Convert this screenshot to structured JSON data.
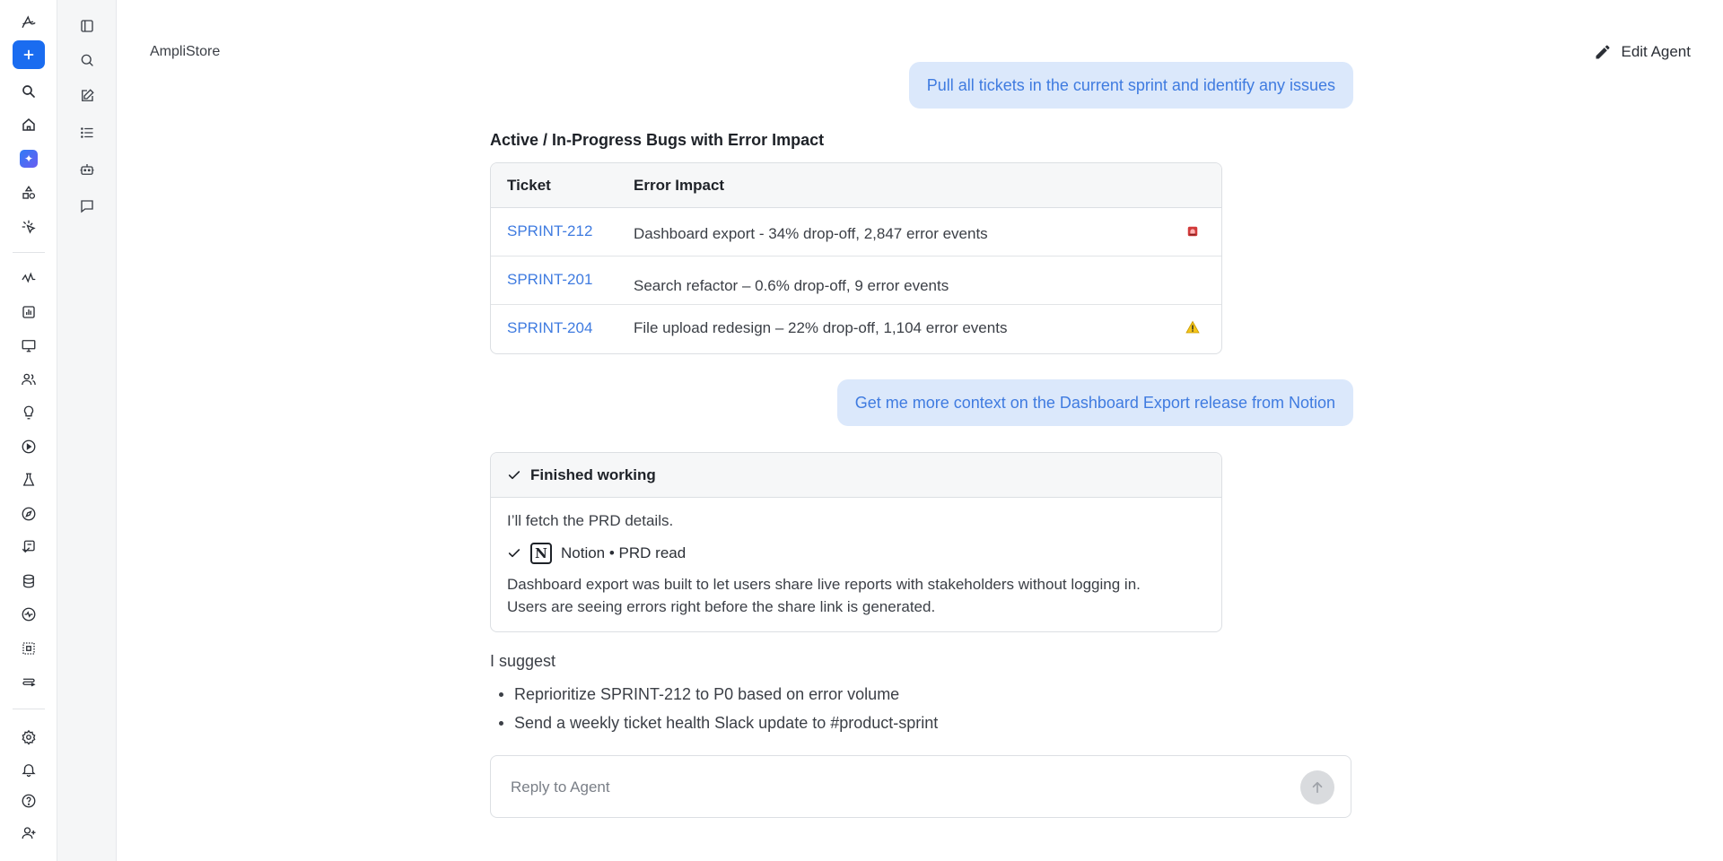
{
  "app": {
    "name": "AmpliStore"
  },
  "header": {
    "edit_agent_label": "Edit Agent"
  },
  "rail": {
    "items": [
      "logo-icon",
      "new-icon",
      "search-icon",
      "home-icon",
      "ai-assistant-icon",
      "shapes-icon",
      "sparkle-cursor-icon",
      "activity-icon",
      "bar-chart-icon",
      "monitor-icon",
      "users-icon",
      "lightbulb-icon",
      "play-circle-icon",
      "flask-icon",
      "compass-icon",
      "guide-icon",
      "database-icon",
      "health-icon",
      "object-icon",
      "flow-icon",
      "settings-icon",
      "bell-icon",
      "help-icon",
      "add-user-icon"
    ],
    "accent": "#1a6cf0"
  },
  "rail2": {
    "items": [
      "sidebar-toggle-icon",
      "search-icon",
      "edit-icon",
      "list-icon",
      "bot-icon",
      "chat-icon"
    ]
  },
  "conversation": {
    "user_msg_1": "Pull all tickets in the current sprint and identify any issues",
    "user_msg_2": "Get me more context on the Dashboard Export release from Notion",
    "table_title": "Active / In-Progress Bugs with Error Impact",
    "table": {
      "headers": [
        "Ticket",
        "Error Impact"
      ],
      "rows": [
        {
          "ticket": "SPRINT-212",
          "impact": "Dashboard export - 34% drop-off, 2,847 error events",
          "flag": "siren-icon"
        },
        {
          "ticket": "SPRINT-201",
          "impact": "Search refactor – 0.6% drop-off, 9 error events",
          "flag": ""
        },
        {
          "ticket": "SPRINT-204",
          "impact": "File upload redesign – 22% drop-off, 1,104 error events",
          "flag": "warning-icon"
        }
      ]
    },
    "work": {
      "status": "Finished working",
      "line1": "I’ll fetch the PRD details.",
      "tool": "Notion • PRD read",
      "desc_1": "Dashboard export was built to let users share live reports with stakeholders without logging in.",
      "desc_2": "Users are seeing errors right before the share link is generated."
    },
    "suggest": {
      "title": "I suggest",
      "items": [
        "Reprioritize SPRINT-212 to P0 based on error volume",
        "Send a weekly ticket health Slack update to #product-sprint"
      ]
    }
  },
  "reply": {
    "placeholder": "Reply to Agent",
    "value": ""
  }
}
